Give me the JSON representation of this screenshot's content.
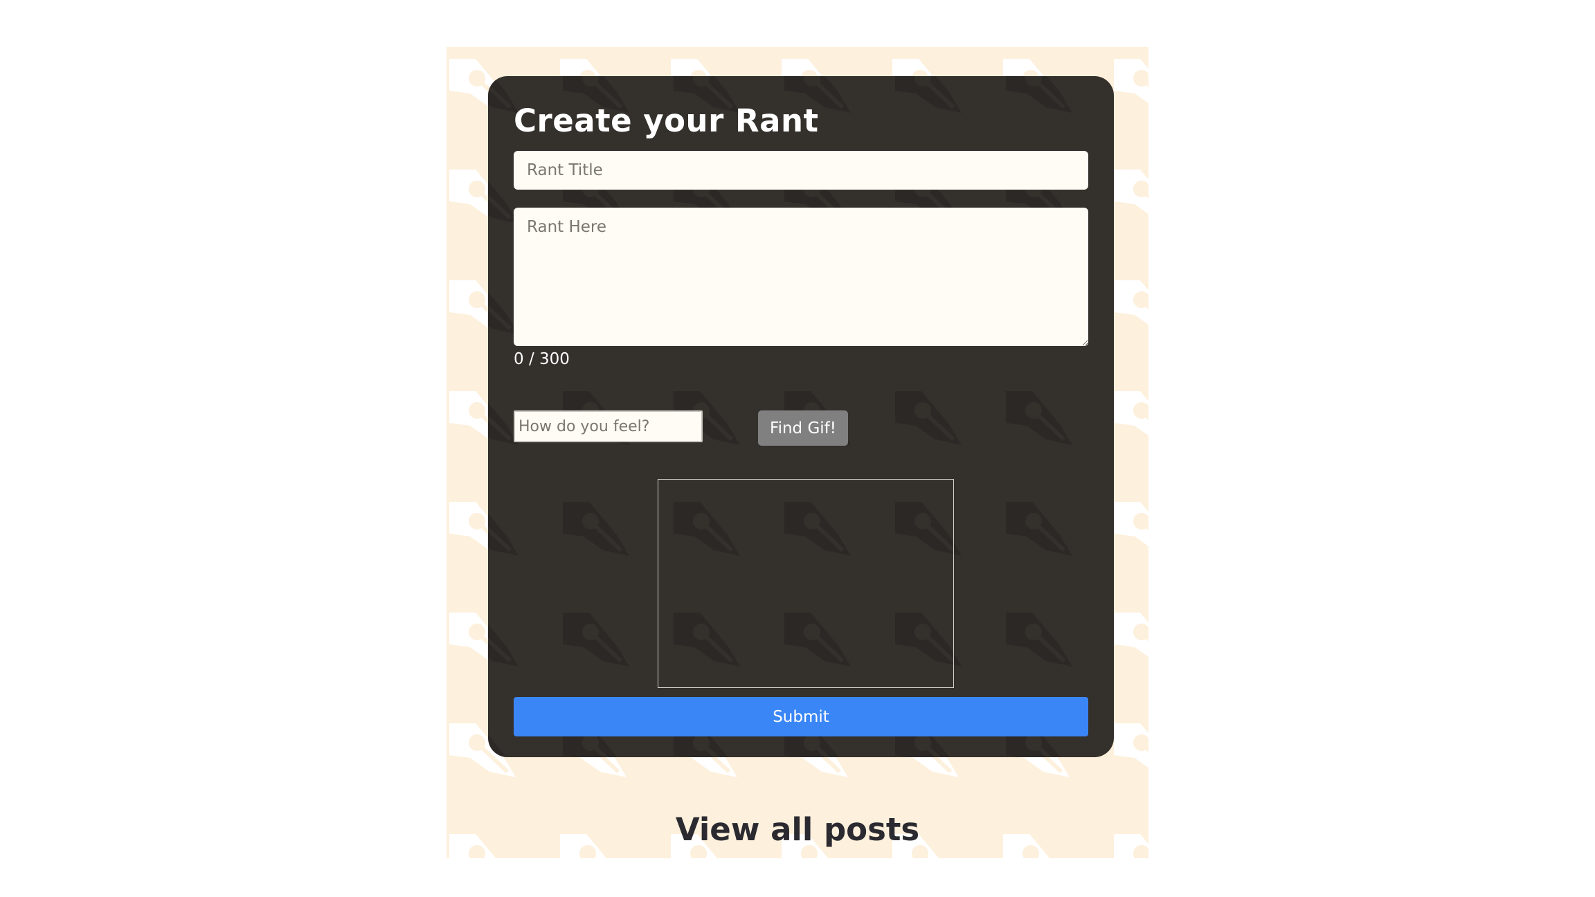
{
  "form": {
    "heading": "Create your Rant",
    "title_placeholder": "Rant Title",
    "title_value": "",
    "body_placeholder": "Rant Here",
    "body_value": "",
    "char_count": "0 / 300",
    "feel_placeholder": "How do you feel?",
    "feel_value": "",
    "find_gif_label": "Find Gif!",
    "submit_label": "Submit"
  },
  "footer": {
    "view_all_label": "View all posts"
  },
  "colors": {
    "page_background": "#fdf0dc",
    "card_background": "#34302c",
    "submit_accent": "#3b86f6",
    "find_gif_button": "#808080"
  },
  "icons": {
    "background_pattern": "fountain-pen-nib-icon"
  }
}
